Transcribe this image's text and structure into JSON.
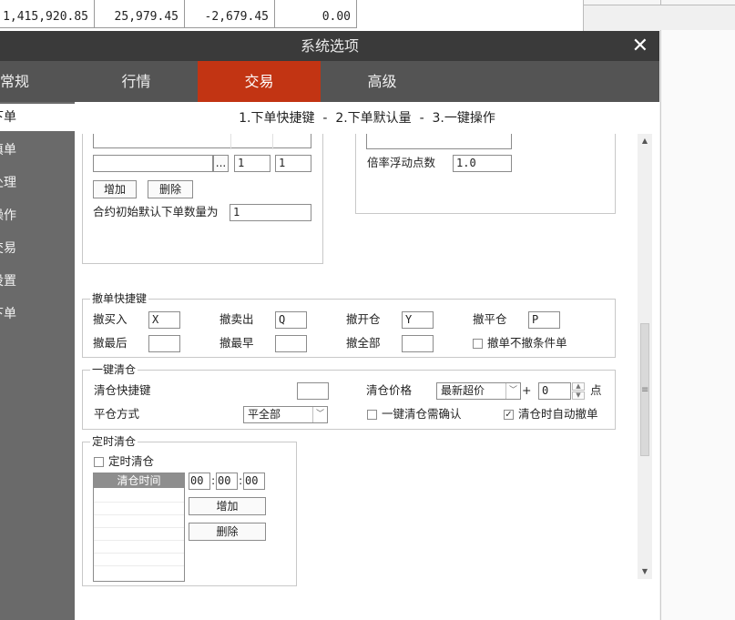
{
  "background_table": {
    "cells": [
      "1,415,920.85",
      "25,979.45",
      "-2,679.45",
      "0.00"
    ]
  },
  "dialog": {
    "title": "系统选项",
    "close_glyph": "✕",
    "tabs": [
      {
        "label": "常规",
        "active": false
      },
      {
        "label": "行情",
        "active": false
      },
      {
        "label": "交易",
        "active": true
      },
      {
        "label": "高级",
        "active": false
      }
    ],
    "sidebar": [
      {
        "label": "下单",
        "active": true
      },
      {
        "label": "填单",
        "active": false
      },
      {
        "label": "处理",
        "active": false
      },
      {
        "label": "操作",
        "active": false
      },
      {
        "label": "交易",
        "active": false
      },
      {
        "label": "设置",
        "active": false
      },
      {
        "label": "下单",
        "active": false
      }
    ],
    "subnav": "1.下单快捷键  -  2.下单默认量  -  3.一键操作"
  },
  "top_section": {
    "browse_label": "...",
    "qty1_value": "1",
    "qty2_value": "1",
    "add_label": "增加",
    "delete_label": "删除",
    "default_qty_label": "合约初始默认下单数量为",
    "default_qty_value": "1",
    "ratio_label": "倍率浮动点数",
    "ratio_value": "1.0"
  },
  "cancel_hotkeys": {
    "title": "撤单快捷键",
    "cancel_buy_label": "撤买入",
    "cancel_buy_value": "X",
    "cancel_sell_label": "撤卖出",
    "cancel_sell_value": "Q",
    "cancel_open_label": "撤开仓",
    "cancel_open_value": "Y",
    "cancel_close_label": "撤平仓",
    "cancel_close_value": "P",
    "cancel_last_label": "撤最后",
    "cancel_last_value": "",
    "cancel_earliest_label": "撤最早",
    "cancel_earliest_value": "",
    "cancel_all_label": "撤全部",
    "cancel_all_value": "",
    "no_conditional_label": "撤单不撤条件单",
    "no_conditional_checked": false
  },
  "one_key_close": {
    "title": "一键清仓",
    "hotkey_label": "清仓快捷键",
    "hotkey_value": "",
    "price_label": "清仓价格",
    "price_value": "最新超价",
    "plus": "+",
    "offset_value": "0",
    "points_label": "点",
    "method_label": "平仓方式",
    "method_value": "平全部",
    "confirm_label": "一键清仓需确认",
    "confirm_checked": false,
    "auto_cancel_label": "清仓时自动撤单",
    "auto_cancel_checked": true
  },
  "timed_close": {
    "title": "定时清仓",
    "enable_label": "定时清仓",
    "enable_checked": false,
    "list_header": "清仓时间",
    "hour": "00",
    "minute": "00",
    "second": "00",
    "sep": ":",
    "add_label": "增加",
    "delete_label": "删除"
  },
  "icons": {
    "scroll_up": "▲",
    "scroll_down": "▼",
    "grip": "≡",
    "dropdown": "﹀",
    "check": "✓",
    "spin_up": "▲",
    "spin_down": "▼"
  },
  "colors": {
    "titlebar": "#3a3a3a",
    "tabbar": "#545454",
    "active_tab": "#c23413",
    "sidebar": "#6a6a6a"
  }
}
